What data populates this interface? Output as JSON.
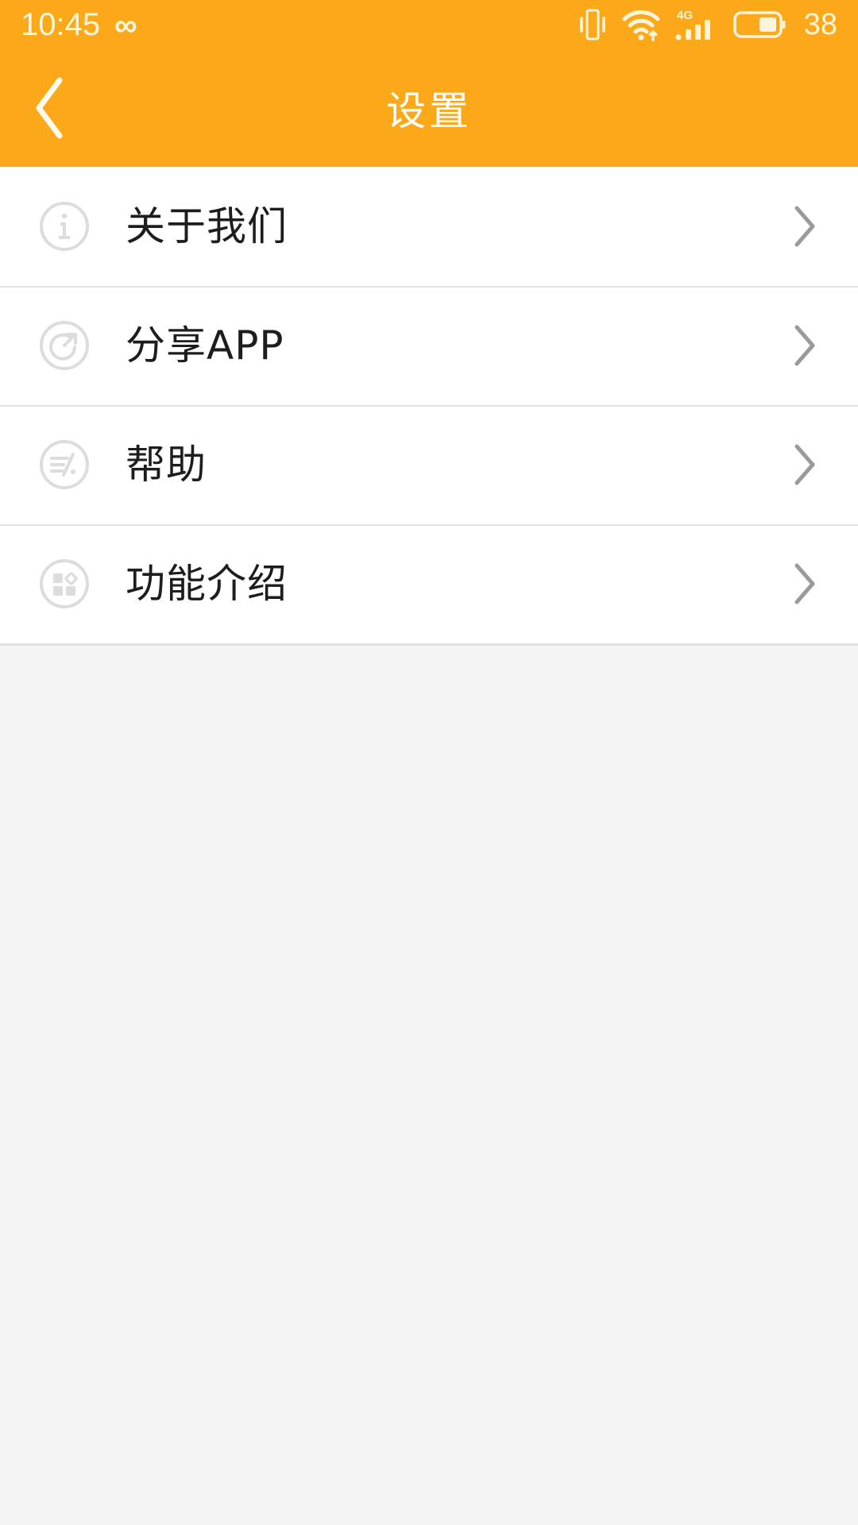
{
  "status_bar": {
    "time": "10:45",
    "infinity_glyph": "∞",
    "battery_percent": "38",
    "icons": [
      "vibrate-icon",
      "wifi-icon",
      "signal-4g-icon",
      "battery-icon"
    ],
    "network_label": "4G",
    "background_color": "#FBA919",
    "text_color": "#FFF3DC"
  },
  "header": {
    "title": "设置",
    "back_icon": "chevron-left-icon",
    "background_color": "#FBA919",
    "title_color": "#FFFFFF"
  },
  "list": {
    "chevron_icon": "chevron-right-icon",
    "divider_color": "#E2E2E2",
    "row_background": "#FFFFFF",
    "page_background": "#F4F4F4",
    "items": [
      {
        "label": "关于我们",
        "icon": "info-circle-icon"
      },
      {
        "label": "分享APP",
        "icon": "share-circle-icon"
      },
      {
        "label": "帮助",
        "icon": "help-document-icon"
      },
      {
        "label": "功能介绍",
        "icon": "grid-features-icon"
      }
    ]
  }
}
